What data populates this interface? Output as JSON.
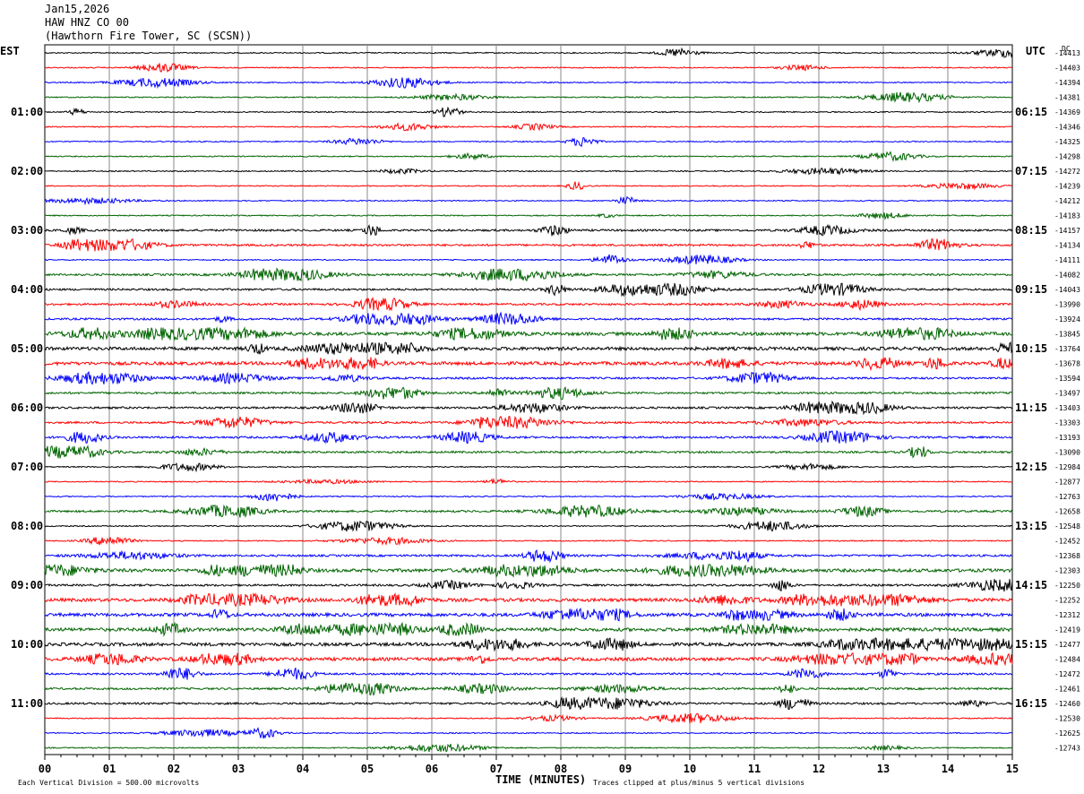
{
  "header": {
    "date": "Jan15,2026",
    "station": "HAW HNZ CO 00",
    "location": "(Hawthorn Fire Tower, SC (SCSN))"
  },
  "left_label": "EST",
  "right_label": "UTC",
  "dc_label": "DC",
  "footer": {
    "scale": "Each Vertical Division =  500.00 microvolts",
    "xlabel": "TIME (MINUTES)",
    "clip": "Traces clipped at plus/minus 5 vertical divisions"
  },
  "chart_data": {
    "type": "line",
    "title": "",
    "xlabel": "TIME (MINUTES)",
    "xlim": [
      0,
      15
    ],
    "x_ticks": [
      "00",
      "01",
      "02",
      "03",
      "04",
      "05",
      "06",
      "07",
      "08",
      "09",
      "10",
      "11",
      "12",
      "13",
      "14",
      "15"
    ],
    "trace_colors": [
      "#000000",
      "#ff0000",
      "#0000ff",
      "#006400"
    ],
    "left_hour_labels": [
      "01:00",
      "02:00",
      "03:00",
      "04:00",
      "05:00",
      "06:00",
      "07:00",
      "08:00",
      "09:00",
      "10:00",
      "11:00"
    ],
    "right_hour_labels": [
      "06:15",
      "07:15",
      "08:15",
      "09:15",
      "10:15",
      "11:15",
      "12:15",
      "13:15",
      "14:15",
      "15:15",
      "16:15"
    ],
    "dc_offsets": [
      -14413,
      -14403,
      -14394,
      -14381,
      -14369,
      -14346,
      -14325,
      -14298,
      -14272,
      -14239,
      -14212,
      -14183,
      -14157,
      -14134,
      -14111,
      -14082,
      -14043,
      -13990,
      -13924,
      -13845,
      -13764,
      -13678,
      -13594,
      -13497,
      -13403,
      -13303,
      -13193,
      -13090,
      -12984,
      -12877,
      -12763,
      -12658,
      -12548,
      -12452,
      -12368,
      -12303,
      -12250,
      -12252,
      -12312,
      -12419,
      -12477,
      -12484,
      -12472,
      -12461,
      -12460,
      -12530,
      -12625,
      -12743
    ],
    "trace_activity": [
      1,
      1,
      1,
      1,
      1,
      1,
      1,
      1,
      1,
      1,
      1,
      1,
      2,
      2,
      1,
      2,
      2,
      2,
      2,
      3,
      3,
      3,
      2,
      2,
      2,
      2,
      2,
      2,
      1,
      1,
      1,
      2,
      1,
      1,
      2,
      3,
      2,
      3,
      3,
      3,
      3,
      3,
      2,
      2,
      2,
      1,
      1,
      1
    ]
  }
}
